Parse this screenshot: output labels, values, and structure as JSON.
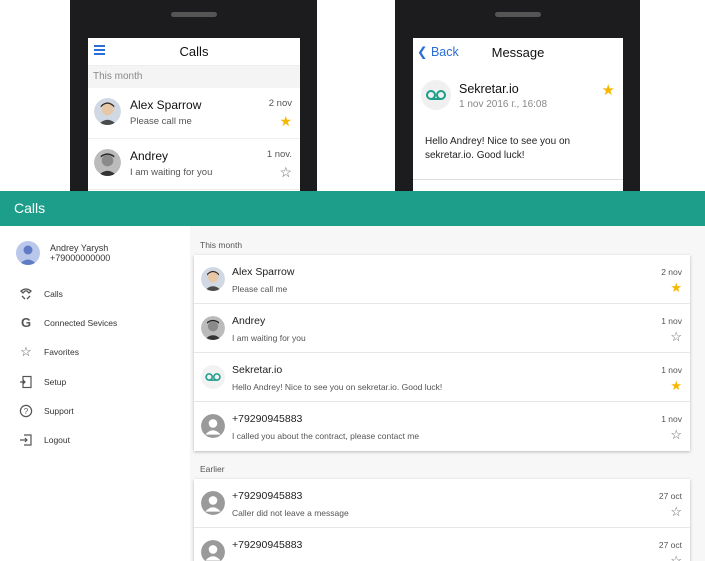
{
  "phone_list": {
    "title": "Calls",
    "section": "This month",
    "rows": [
      {
        "name": "Alex Sparrow",
        "sub": "Please call me",
        "date": "2 nov",
        "starred": true
      },
      {
        "name": "Andrey",
        "sub": "I am waiting for you",
        "date": "1 nov.",
        "starred": false
      }
    ]
  },
  "phone_message": {
    "back_label": "Back",
    "title": "Message",
    "sender": "Sekretar.io",
    "timestamp": "1 nov 2016 г., 16:08",
    "body": "Hello Andrey! Nice to see you on sekretar.io. Good luck!"
  },
  "app": {
    "title": "Calls",
    "accent_color": "#1c9e8a",
    "star_color": "#f5b700"
  },
  "sidebar": {
    "user_name": "Andrey Yarysh",
    "user_phone": "+79000000000",
    "items": [
      {
        "label": "Calls",
        "icon": "phone-icon"
      },
      {
        "label": "Connected Sevices",
        "icon": "google-icon"
      },
      {
        "label": "Favorites",
        "icon": "star-icon"
      },
      {
        "label": "Setup",
        "icon": "setup-icon"
      },
      {
        "label": "Support",
        "icon": "help-icon"
      },
      {
        "label": "Logout",
        "icon": "logout-icon"
      }
    ]
  },
  "content": {
    "section_this_month": "This month",
    "this_month": [
      {
        "name": "Alex Sparrow",
        "sub": "Please call me",
        "date": "2 nov",
        "starred": true,
        "avatar": "photo-alex"
      },
      {
        "name": "Andrey",
        "sub": "I am waiting for you",
        "date": "1 nov",
        "starred": false,
        "avatar": "photo-andrey"
      },
      {
        "name": "Sekretar.io",
        "sub": "Hello Andrey! Nice to see you on sekretar.io. Good luck!",
        "date": "1 nov",
        "starred": true,
        "avatar": "voicemail-icon"
      },
      {
        "name": "+79290945883",
        "sub": "I called you about the contract, please contact me",
        "date": "1 nov",
        "starred": false,
        "avatar": "person-icon"
      }
    ],
    "section_earlier": "Earlier",
    "earlier": [
      {
        "name": "+79290945883",
        "sub": "Caller did not leave a message",
        "date": "27 oct",
        "starred": false,
        "avatar": "person-icon"
      },
      {
        "name": "+79290945883",
        "sub": "",
        "date": "27 oct",
        "starred": false,
        "avatar": "person-icon"
      }
    ]
  }
}
